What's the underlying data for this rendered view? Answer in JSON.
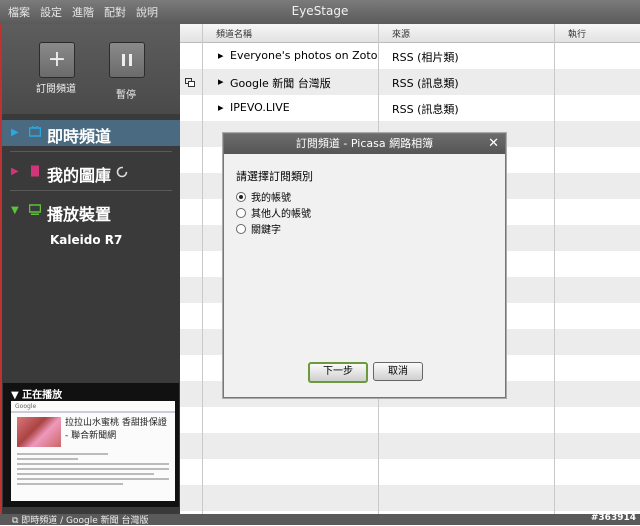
{
  "window": {
    "title": "EyeStage"
  },
  "menu": [
    "檔案",
    "設定",
    "進階",
    "配對",
    "說明"
  ],
  "toolbar": {
    "subscribe_label": "訂閱頻道",
    "pause_label": "暫停"
  },
  "sidebar": {
    "items": [
      {
        "label": "即時頻道",
        "color": "#2aa9e0"
      },
      {
        "label": "我的圖庫",
        "color": "#d0357a"
      },
      {
        "label": "播放裝置",
        "color": "#5cc23a"
      }
    ],
    "device": "Kaleido R7"
  },
  "now_playing": {
    "title": "正在播放",
    "headline": "拉拉山水蜜桃 香甜掛保證 - 聯合新聞網"
  },
  "status": {
    "text": "即時頻道 / Google 新聞 台灣版",
    "watermark": "#363914"
  },
  "table": {
    "headers": [
      "頻道名稱",
      "來源",
      "執行"
    ],
    "rows": [
      {
        "name": "Everyone's photos on Zoto",
        "source": "RSS (相片類)"
      },
      {
        "name": "Google 新聞 台灣版",
        "source": "RSS (訊息類)"
      },
      {
        "name": "IPEVO.LIVE",
        "source": "RSS (訊息類)"
      }
    ]
  },
  "dialog": {
    "title": "訂閱頻道 - Picasa 網路相簿",
    "prompt": "請選擇訂閱類別",
    "options": [
      "我的帳號",
      "其他人的帳號",
      "關鍵字"
    ],
    "selected": 0,
    "next_label": "下一步",
    "cancel_label": "取消"
  }
}
